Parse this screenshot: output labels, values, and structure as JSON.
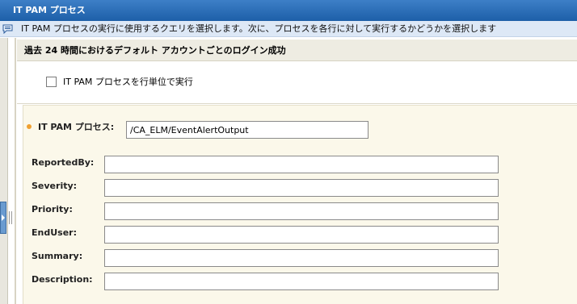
{
  "window": {
    "title": "IT PAM プロセス"
  },
  "info": {
    "text": "IT PAM プロセスの実行に使用するクエリを選択します。次に、プロセスを各行に対して実行するかどうかを選択します",
    "icon": "info-speech-icon"
  },
  "section": {
    "title": "過去 24 時間におけるデフォルト アカウントごとのログイン成功"
  },
  "options": {
    "per_row_label": "IT PAM プロセスを行単位で実行",
    "per_row_checked": false
  },
  "form": {
    "process_label": "IT PAM プロセス:",
    "process_value": "/CA_ELM/EventAlertOutput",
    "fields": [
      {
        "label": "ReportedBy:",
        "value": ""
      },
      {
        "label": "Severity:",
        "value": ""
      },
      {
        "label": "Priority:",
        "value": ""
      },
      {
        "label": "EndUser:",
        "value": ""
      },
      {
        "label": "Summary:",
        "value": ""
      },
      {
        "label": "Description:",
        "value": ""
      }
    ]
  },
  "colors": {
    "titlebar": "#1d5fa8",
    "infobar": "#dde8f6",
    "form_background": "#fbf8ea",
    "required_marker": "#f0a030"
  }
}
